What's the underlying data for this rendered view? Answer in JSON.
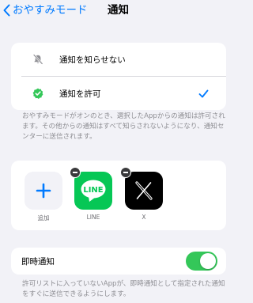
{
  "nav": {
    "back_label": "おやすみモード",
    "title": "通知"
  },
  "notification_options": {
    "items": [
      {
        "label": "通知を知らせない",
        "icon": "bell-slash-icon",
        "selected": false
      },
      {
        "label": "通知を許可",
        "icon": "green-check-circle-icon",
        "selected": true
      }
    ]
  },
  "description": "おやすみモードがオンのとき、選択したAppからの通知は許可されます。その他からの通知はすべて知らされないようになり、通知センターに送信されます。",
  "allowed_apps": {
    "add_label": "追加",
    "apps": [
      {
        "name": "LINE",
        "icon": "line-app-icon",
        "badge": "LINE"
      },
      {
        "name": "X",
        "icon": "x-app-icon"
      }
    ]
  },
  "immediate": {
    "label": "即時通知",
    "enabled": true,
    "footnote": "許可リストに入っていないAppが、即時通知として指定された通知をすぐに送信できるようにします。"
  },
  "colors": {
    "accent": "#007aff",
    "toggle_on": "#34c759",
    "line_green": "#06c755",
    "check_green": "#34c759"
  }
}
